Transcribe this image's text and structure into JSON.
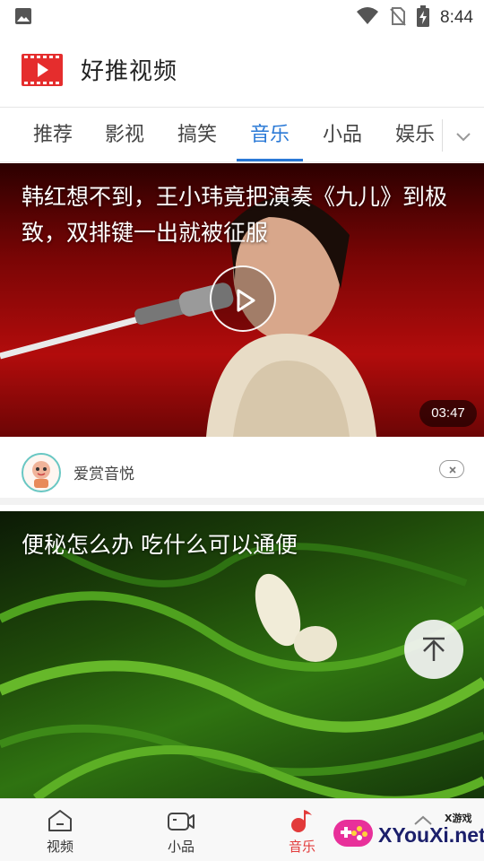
{
  "status_bar": {
    "time": "8:44"
  },
  "app": {
    "title": "好推视频"
  },
  "tabs": [
    {
      "label": "推荐"
    },
    {
      "label": "影视"
    },
    {
      "label": "搞笑"
    },
    {
      "label": "音乐"
    },
    {
      "label": "小品"
    },
    {
      "label": "娱乐"
    }
  ],
  "active_tab": "音乐",
  "feed": [
    {
      "title": "韩红想不到，王小玮竟把演奏《九儿》到极致，双排键一出就被征服",
      "duration": "03:47",
      "author": "爱赏音悦"
    },
    {
      "title": "便秘怎么办 吃什么可以通便"
    }
  ],
  "bottom_nav": [
    {
      "label": "视频",
      "icon": "home-icon"
    },
    {
      "label": "小品",
      "icon": "video-camera-icon"
    },
    {
      "label": "音乐",
      "icon": "music-note-icon"
    }
  ],
  "watermark": {
    "text": "XYouXi.net",
    "small": "X游戏"
  },
  "colors": {
    "accent": "#2a79d6",
    "nav_active": "#e23a3a",
    "logo_red": "#e52d2d"
  }
}
